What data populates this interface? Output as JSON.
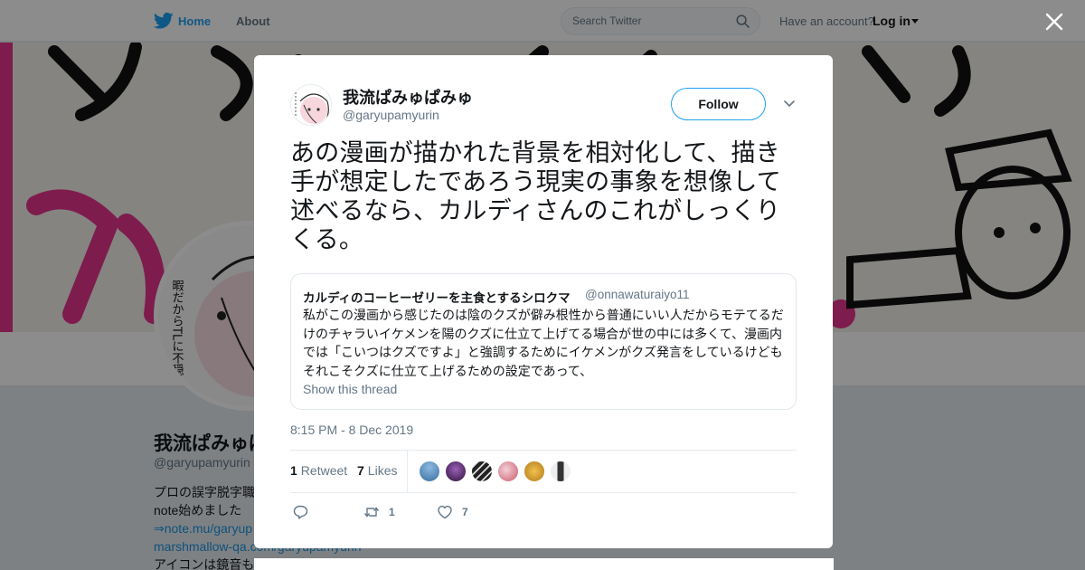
{
  "topbar": {
    "home_label": "Home",
    "about_label": "About",
    "search_placeholder": "Search Twitter",
    "have_account": "Have an account?",
    "login_label": "Log in"
  },
  "profile": {
    "name": "我流ぱみゅぱみゅ",
    "handle": "@garyupamyurin",
    "bio_lines": [
      "プロの誤字脱字職",
      "note始めました",
      "⇒note.mu/garyup",
      "marshmallow-qa.com/garyupamyurin",
      "アイコンは鏡音も"
    ]
  },
  "tweet": {
    "author_name": "我流ぱみゅぱみゅ",
    "author_handle": "@garyupamyurin",
    "follow_label": "Follow",
    "text": "あの漫画が描かれた背景を相対化して、描き手が想定したであろう現実の事象を想像して述べるなら、カルディさんのこれがしっくりくる。",
    "quote": {
      "name": "カルディのコーヒーゼリーを主食とするシロクマ",
      "handle": "@onnawaturaiyo11",
      "text": "私がこの漫画から感じたのは陰のクズが僻み根性から普通にいい人だからモテてるだけのチャラいイケメンを陽のクズに仕立て上げてる場合が世の中には多くて、漫画内では「こいつはクズですよ」と強調するためにイケメンがクズ発言をしているけどもそれこそクズに仕立て上げるための設定であって、",
      "show_thread": "Show this thread"
    },
    "timestamp": "8:15 PM - 8 Dec 2019",
    "retweets_count": "1",
    "retweets_label": "Retweet",
    "likes_count": "7",
    "likes_label": "Likes",
    "action_retweet_count": "1",
    "action_like_count": "7"
  },
  "colors": {
    "accent": "#1da1f2",
    "banner_pink": "#e6348c",
    "avatar_colors": [
      "#3a6fa0",
      "#4b2a5e",
      "#2a2a2a",
      "#d9a0a8",
      "#d8a640",
      "#e0e0e0"
    ]
  }
}
